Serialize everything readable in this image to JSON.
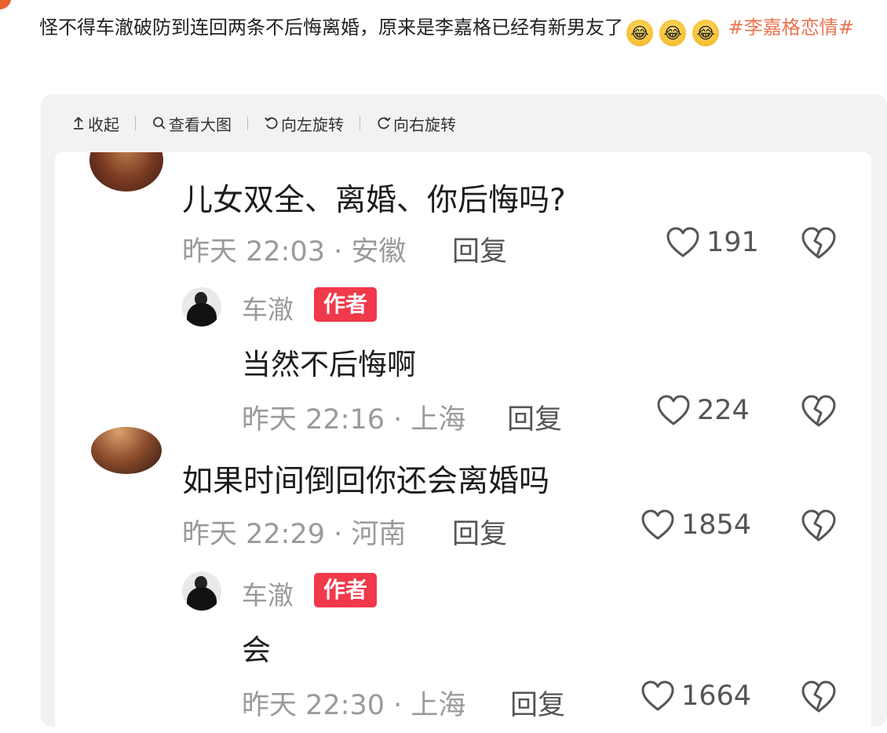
{
  "post": {
    "text": "怪不得车澈破防到连回两条不后悔离婚，原来是李嘉格已经有新男友了",
    "emojis": [
      "😂",
      "😂",
      "😂"
    ],
    "hashtag": "#李嘉格恋情#"
  },
  "toolbar": {
    "collapse_label": "收起",
    "view_large_label": "查看大图",
    "rotate_left_label": "向左旋转",
    "rotate_right_label": "向右旋转"
  },
  "comments": [
    {
      "text": "儿女双全、离婚、你后悔吗?",
      "meta": "昨天 22:03 · 安徽",
      "reply_label": "回复",
      "likes": "191",
      "reply": {
        "author": "车澈",
        "badge": "作者",
        "text": "当然不后悔啊",
        "meta": "昨天 22:16 · 上海",
        "reply_label": "回复",
        "likes": "224"
      }
    },
    {
      "text": "如果时间倒回你还会离婚吗",
      "meta": "昨天 22:29 · 河南",
      "reply_label": "回复",
      "likes": "1854",
      "reply": {
        "author": "车澈",
        "badge": "作者",
        "text": "会",
        "meta": "昨天 22:30 · 上海",
        "reply_label": "回复",
        "likes": "1664"
      }
    }
  ],
  "icons": {
    "collapse": "arrow-up-icon",
    "view_large": "search-icon",
    "rotate_left": "rotate-left-icon",
    "rotate_right": "rotate-right-icon",
    "like": "heart-icon",
    "dislike": "broken-heart-icon"
  },
  "colors": {
    "hashtag": "#eb7350",
    "author_badge": "#f0394b",
    "panel_bg": "#f2f2f5"
  }
}
